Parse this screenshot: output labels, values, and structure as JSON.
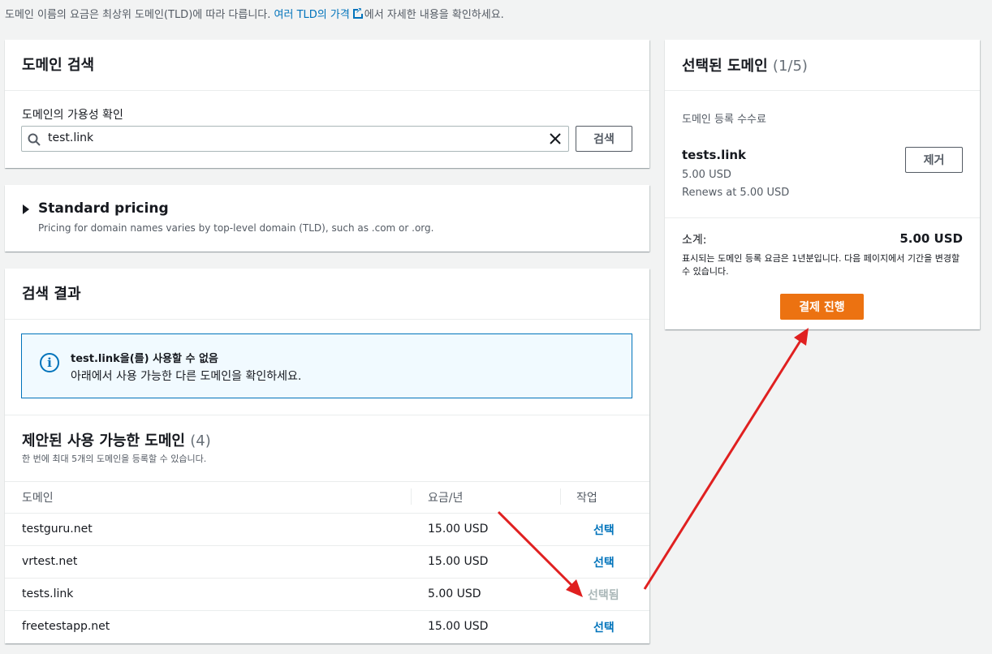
{
  "top_note": {
    "prefix": "도메인 이름의 요금은 최상위 도메인(TLD)에 따라 다릅니다. ",
    "link": "여러 TLD의 가격",
    "suffix": "에서 자세한 내용을 확인하세요."
  },
  "search_card": {
    "title": "도메인 검색",
    "field_label": "도메인의 가용성 확인",
    "input_value": "test.link",
    "search_button": "검색"
  },
  "pricing_card": {
    "title": "Standard pricing",
    "description": "Pricing for domain names varies by top-level domain (TLD), such as .com or .org."
  },
  "results_card": {
    "title": "검색 결과",
    "alert_title": "test.link을(를) 사용할 수 없음",
    "alert_body": "아래에서 사용 가능한 다른 도메인을 확인하세요.",
    "suggested_title": "제안된 사용 가능한 도메인",
    "suggested_count": "(4)",
    "suggested_note": "한 번에 최대 5개의 도메인을 등록할 수 있습니다.",
    "columns": [
      "도메인",
      "요금/년",
      "작업"
    ],
    "rows": [
      {
        "domain": "testguru.net",
        "price": "15.00 USD",
        "action": "선택"
      },
      {
        "domain": "vrtest.net",
        "price": "15.00 USD",
        "action": "선택"
      },
      {
        "domain": "tests.link",
        "price": "5.00 USD",
        "action": "선택됨"
      },
      {
        "domain": "freetestapp.net",
        "price": "15.00 USD",
        "action": "선택"
      }
    ]
  },
  "selected_card": {
    "title": "선택된 도메인",
    "count": "(1/5)",
    "fee_label": "도메인 등록 수수료",
    "domain": "tests.link",
    "price": "5.00 USD",
    "renews": "Renews at 5.00 USD",
    "remove_button": "제거",
    "subtotal_label": "소계:",
    "subtotal_value": "5.00 USD",
    "note": "표시되는 도메인 등록 요금은 1년분입니다. 다음 페이지에서 기간을 변경할 수 있습니다.",
    "checkout_button": "결제 진행"
  },
  "colors": {
    "accent": "#0073bb",
    "primary_button": "#ec7211",
    "arrow": "#e02020"
  }
}
